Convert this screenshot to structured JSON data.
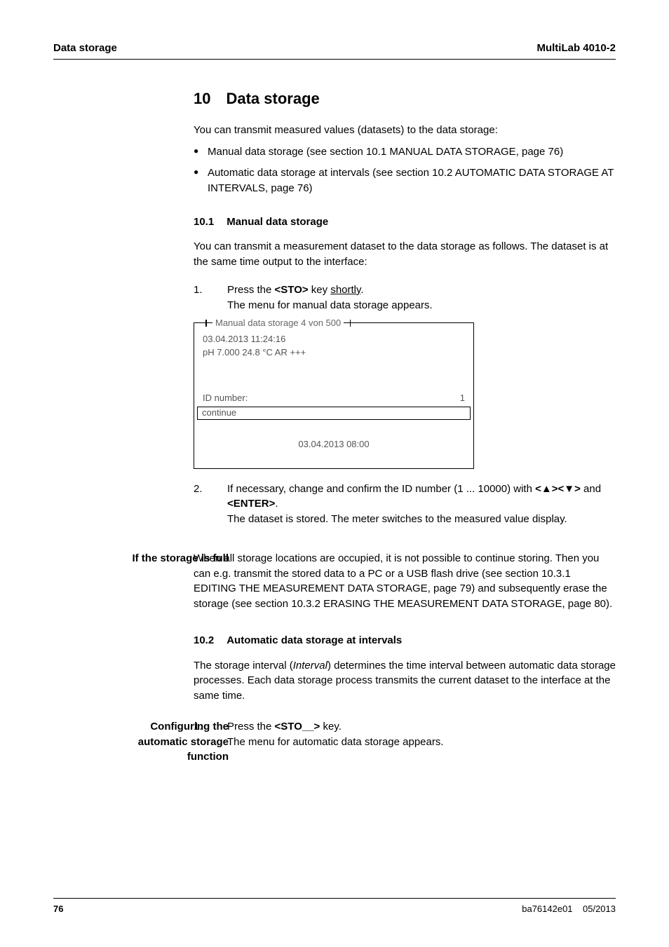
{
  "header": {
    "left": "Data storage",
    "right": "MultiLab 4010-2"
  },
  "h1": {
    "num": "10",
    "title": "Data storage"
  },
  "intro": "You can transmit measured values (datasets) to the data storage:",
  "bullets": [
    {
      "pre": "Manual data storage (see section 10.1 M",
      "caps": "ANUAL DATA STORAGE",
      "post": ", page 76)"
    },
    {
      "pre": "Automatic data storage at intervals (see section 10.2 A",
      "caps": "UTOMATIC DATA STORAGE AT INTERVALS",
      "post": ", page 76)"
    }
  ],
  "s101": {
    "num": "10.1",
    "title": "Manual data storage",
    "para": "You can transmit a measurement dataset to the data storage as follows. The dataset is at the same time output to the interface:",
    "step1": {
      "n": "1.",
      "t1a": "Press the ",
      "key": "<STO>",
      "t1b": " key ",
      "short": "shortly",
      "t1c": ".",
      "t2": "The menu for manual data storage appears."
    },
    "device": {
      "title": "Manual data storage 4 von 500",
      "line1": "03.04.2013  11:24:16",
      "line2": "pH 7.000    24.8 °C  AR  +++",
      "idlabel": "ID number:",
      "idval": "1",
      "cont": "continue",
      "ts": "03.04.2013 08:00"
    },
    "step2": {
      "n": "2.",
      "t1a": "If necessary, change and confirm the ID number (1 ... 10000) with ",
      "keys": "<▲><▼>",
      "and": " and ",
      "enter": "<ENTER>",
      "t2": "The dataset is stored. The meter switches to the measured value display."
    }
  },
  "full": {
    "side": "If the storage is full",
    "t1": "When all storage locations are occupied, it is not possible to continue storing. Then you can e.g. transmit the stored data to a PC or a USB flash drive (see section 10.3.1 E",
    "caps1": "DITING THE MEASUREMENT DATA STORAGE",
    "t2": ", page 79) and subsequently erase the storage (see section 10.3.2 E",
    "caps2": "RASING THE MEASUREMENT DATA STORAGE",
    "t3": ", page 80)."
  },
  "s102": {
    "num": "10.2",
    "title": "Automatic data storage at intervals",
    "para_a": "The storage interval (",
    "para_i": "Interval",
    "para_b": ") determines the time interval between automatic data storage processes. Each data storage process transmits the current dataset to the interface at the same time.",
    "side": "Configuring the automatic storage function",
    "step1": {
      "n": "1.",
      "t1a": "Press the ",
      "key": "<STO__>",
      "t1b": " key.",
      "t2": "The menu for automatic data storage appears."
    }
  },
  "footer": {
    "page": "76",
    "doc": "ba76142e01",
    "date": "05/2013"
  }
}
